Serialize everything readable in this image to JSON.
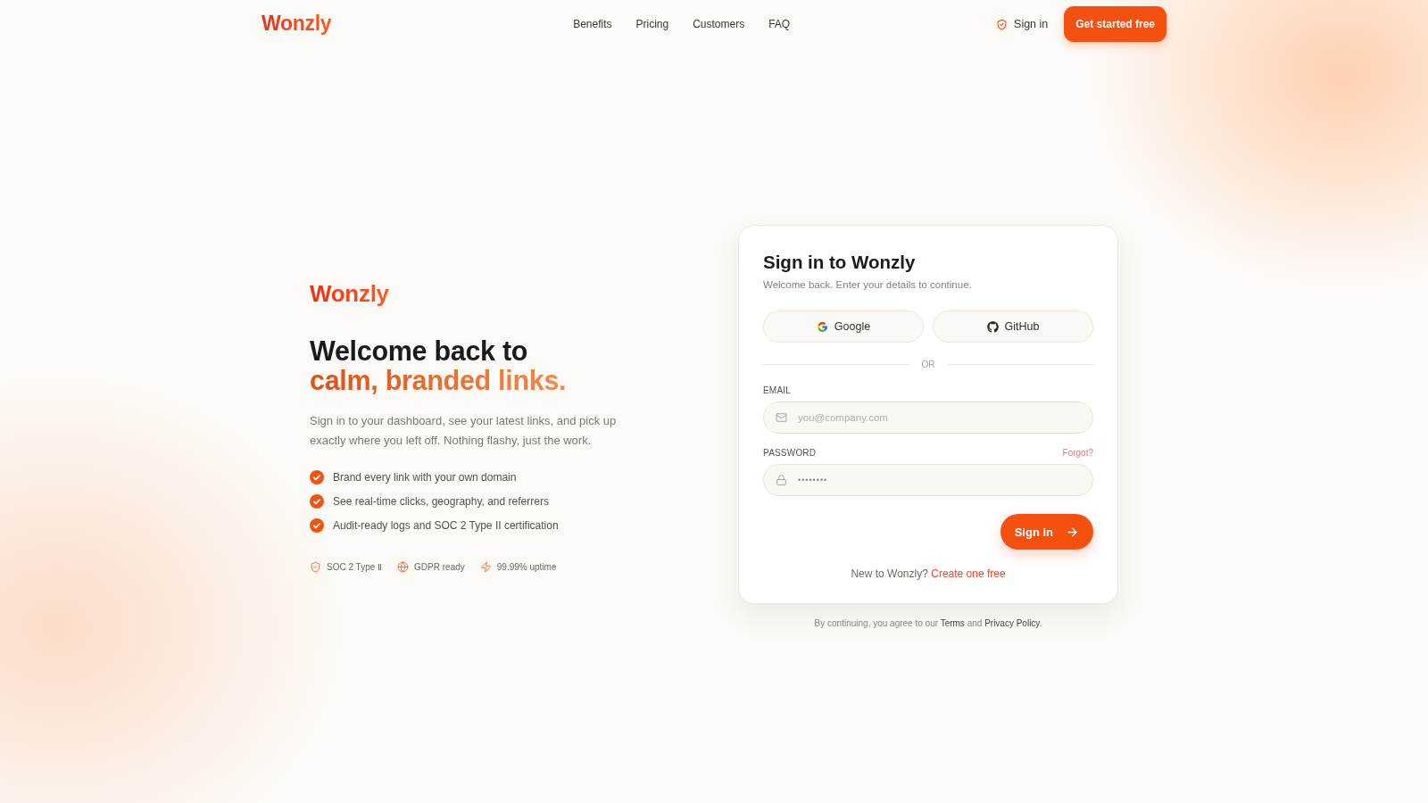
{
  "header": {
    "logo": "Wonzly",
    "nav": [
      "Benefits",
      "Pricing",
      "Customers",
      "FAQ"
    ],
    "sign_in": "Sign in",
    "cta": "Get started free"
  },
  "hero": {
    "logo": "Wonzly",
    "heading_line_1": "Welcome back to",
    "heading_line_2": "calm, branded links.",
    "description": "Sign in to your dashboard, see your latest links, and pick up exactly where you left off. Nothing flashy, just the work.",
    "features": [
      "Brand every link with your own domain",
      "See real-time clicks, geography, and referrers",
      "Audit-ready logs and SOC 2 Type II certification"
    ],
    "badges": [
      {
        "kind": "shield",
        "label": "SOC 2 Type Ⅱ"
      },
      {
        "kind": "globe",
        "label": "GDPR ready"
      },
      {
        "kind": "bolt",
        "label": "99.99% uptime"
      }
    ]
  },
  "card": {
    "title": "Sign in to Wonzly",
    "subtitle": "Welcome back. Enter your details to continue.",
    "social": [
      {
        "kind": "google",
        "label": "Google"
      },
      {
        "kind": "github",
        "label": "GitHub"
      }
    ],
    "divider": "OR",
    "email": {
      "label": "EMAIL",
      "placeholder": "you@company.com"
    },
    "password": {
      "label": "PASSWORD",
      "forgot": "Forgot?",
      "value": "••••••••"
    },
    "submit": "Sign in",
    "signup": {
      "prompt": "New to Wonzly?",
      "link": "Create one free"
    }
  },
  "legal": {
    "prefix": "By continuing, you agree to our",
    "terms": "Terms",
    "joiner": "and",
    "privacy": "Privacy Policy",
    "suffix": "."
  }
}
